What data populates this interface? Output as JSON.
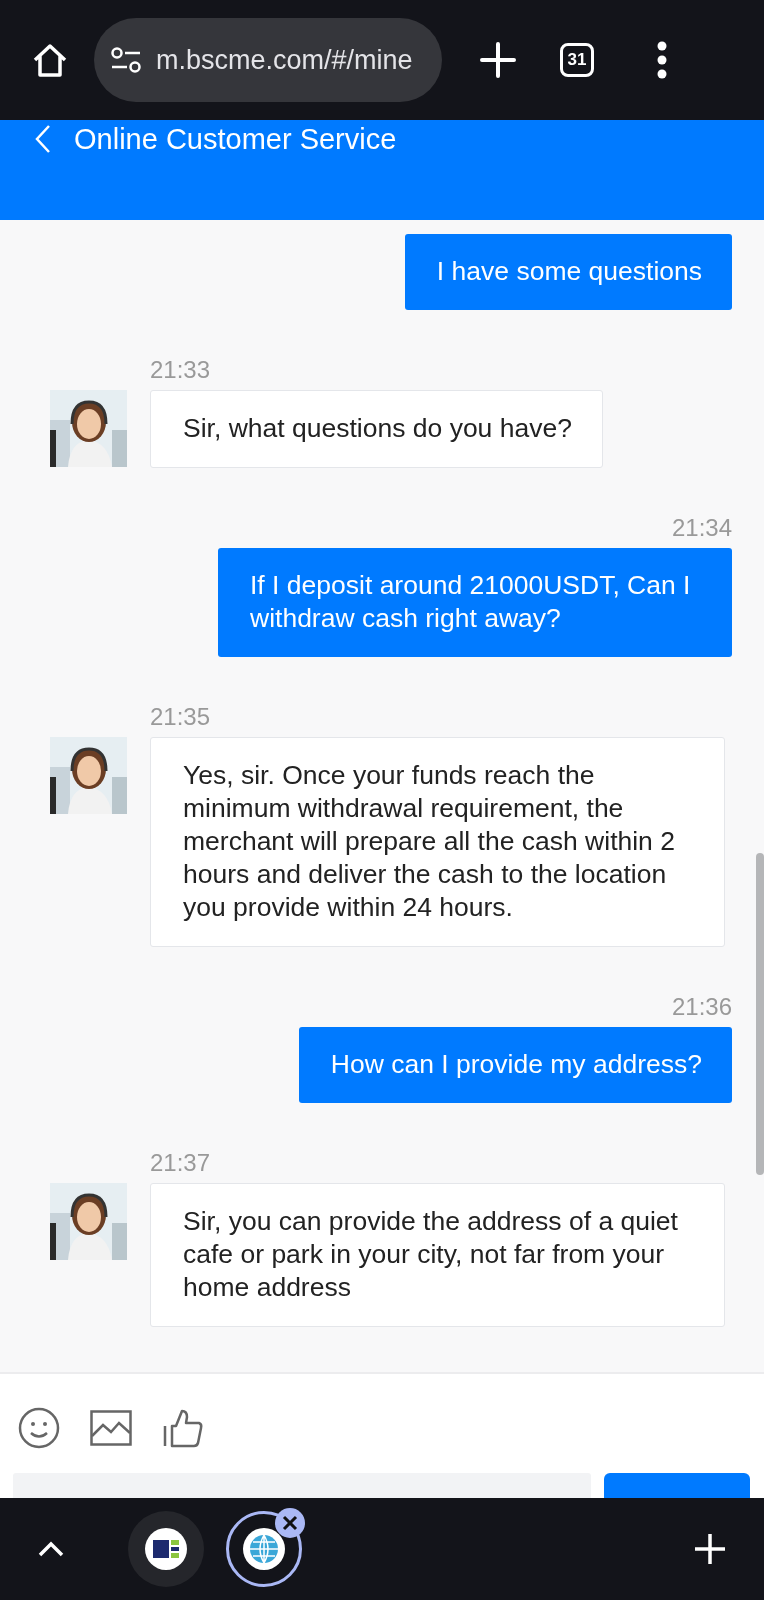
{
  "browser": {
    "url": "m.bscme.com/#/mine",
    "tab_count": "31"
  },
  "header": {
    "title": "Online Customer Service"
  },
  "messages": [
    {
      "kind": "user",
      "text": "I have some questions"
    },
    {
      "kind": "agent",
      "time": "21:33",
      "text": "Sir, what questions do you have?"
    },
    {
      "kind": "user",
      "time": "21:34",
      "text": "If I deposit around 21000USDT, Can I withdraw cash right away?"
    },
    {
      "kind": "agent",
      "time": "21:35",
      "text": "Yes, sir. Once your funds reach the minimum withdrawal requirement, the merchant will prepare all the cash within 2 hours and deliver the cash to the location you provide within 24 hours."
    },
    {
      "kind": "user",
      "time": "21:36",
      "text": "How can I provide my address?"
    },
    {
      "kind": "agent",
      "time": "21:37",
      "text": "Sir, you can provide the address of a quiet cafe or park in your city, not far from your home address"
    }
  ],
  "tab_strip": {
    "tabs": [
      {
        "selected": false
      },
      {
        "selected": true
      }
    ]
  }
}
